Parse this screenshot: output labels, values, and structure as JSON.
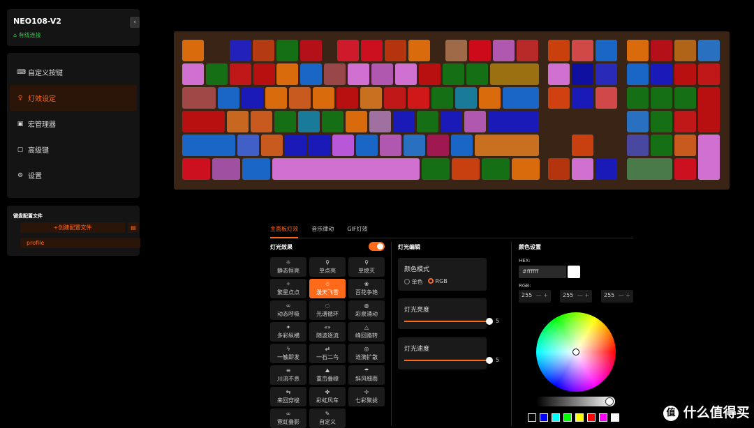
{
  "device": {
    "name": "NEO108-V2",
    "connection": "有线连接"
  },
  "sidebar": {
    "items": [
      {
        "label": "自定义按键",
        "icon": "keyboard-icon"
      },
      {
        "label": "灯效设定",
        "icon": "lightbulb-icon"
      },
      {
        "label": "宏管理器",
        "icon": "macro-icon"
      },
      {
        "label": "高级键",
        "icon": "advanced-key-icon"
      },
      {
        "label": "设置",
        "icon": "gear-icon"
      }
    ]
  },
  "profiles": {
    "title": "键盘配置文件",
    "create_label": "+创建配置文件",
    "items": [
      "profile"
    ]
  },
  "tabs": [
    "主面板灯效",
    "音乐律动",
    "GIF灯效"
  ],
  "effects": {
    "title": "灯光效果",
    "toggle_on": true,
    "items": [
      {
        "label": "静态恒亮",
        "icon": "☼"
      },
      {
        "label": "单点亮",
        "icon": "♀"
      },
      {
        "label": "单熄灭",
        "icon": "♀"
      },
      {
        "label": "繁星点点",
        "icon": "✧"
      },
      {
        "label": "漫天飞雪",
        "icon": "☃"
      },
      {
        "label": "百花争艳",
        "icon": "❀"
      },
      {
        "label": "动态呼吸",
        "icon": "∞"
      },
      {
        "label": "光谱循环",
        "icon": "◌"
      },
      {
        "label": "彩泉涌动",
        "icon": "◍"
      },
      {
        "label": "多彩纵横",
        "icon": "✦"
      },
      {
        "label": "随波逐流",
        "icon": "«»"
      },
      {
        "label": "峰回路转",
        "icon": "△"
      },
      {
        "label": "一触即发",
        "icon": "ϟ"
      },
      {
        "label": "一石二鸟",
        "icon": "⇄"
      },
      {
        "label": "涟漪扩散",
        "icon": "◎"
      },
      {
        "label": "川流不息",
        "icon": "≡"
      },
      {
        "label": "重峦叠嶂",
        "icon": "⛰"
      },
      {
        "label": "斜风细雨",
        "icon": "☂"
      },
      {
        "label": "来回穿梭",
        "icon": "⇆"
      },
      {
        "label": "彩虹风车",
        "icon": "✤"
      },
      {
        "label": "七彩聚拢",
        "icon": "✢"
      },
      {
        "label": "霓虹叠影",
        "icon": "∞"
      },
      {
        "label": "自定义",
        "icon": "✎"
      }
    ]
  },
  "light_edit": {
    "title": "灯光编辑",
    "color_mode": {
      "label": "颜色模式",
      "options": [
        "单色",
        "RGB"
      ],
      "selected": "RGB"
    },
    "brightness": {
      "label": "灯光亮度",
      "value": "5"
    },
    "speed": {
      "label": "灯光速度",
      "value": "5"
    }
  },
  "color_settings": {
    "title": "颜色设置",
    "hex_label": "HEX:",
    "hex_value": "#ffffff",
    "rgb_label": "RGB:",
    "r": "255",
    "g": "255",
    "b": "255",
    "swatches": [
      "#000000",
      "#0000ff",
      "#00ffff",
      "#00ff00",
      "#ffff00",
      "#ff0000",
      "#ff00ff",
      "#ffffff"
    ]
  },
  "watermark": {
    "text": "什么值得买"
  }
}
